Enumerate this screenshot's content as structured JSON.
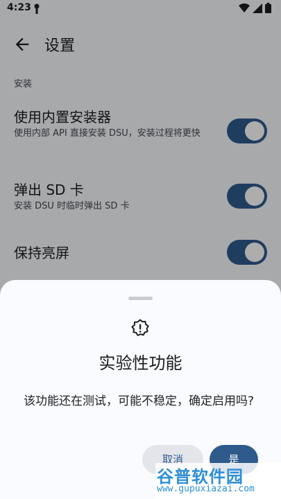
{
  "status_bar": {
    "time": "4:23"
  },
  "app_bar": {
    "title": "设置"
  },
  "section": {
    "header": "安装"
  },
  "prefs": [
    {
      "title": "使用内置安装器",
      "summary": "使用内部 API 直接安装 DSU，安装过程将更快",
      "enabled": true
    },
    {
      "title": "弹出 SD 卡",
      "summary": "安装 DSU 时临时弹出 SD 卡",
      "enabled": true
    },
    {
      "title": "保持亮屏",
      "summary": "",
      "enabled": true
    }
  ],
  "sheet": {
    "title": "实验性功能",
    "message": "该功能还在测试，可能不稳定，确定启用吗?",
    "cancel_label": "取消",
    "confirm_label": "是"
  },
  "watermark": {
    "main": "谷普软件园",
    "url": "www.gupuxiazai.com"
  },
  "colors": {
    "accent": "#2e5a8c",
    "scrim": "rgba(0,0,0,0.32)"
  }
}
